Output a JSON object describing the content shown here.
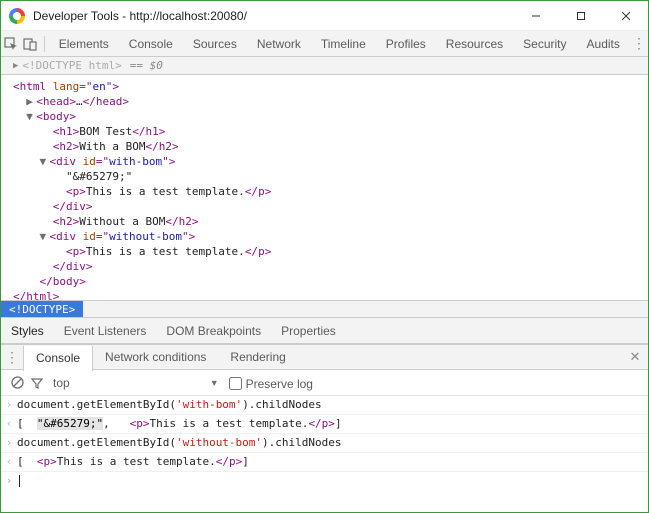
{
  "window": {
    "title": "Developer Tools - http://localhost:20080/"
  },
  "toolbar": {
    "tabs": [
      "Elements",
      "Console",
      "Sources",
      "Network",
      "Timeline",
      "Profiles",
      "Resources",
      "Security",
      "Audits"
    ]
  },
  "breadcrumb": {
    "doctype": "<!DOCTYPE html>",
    "selected": "== $0"
  },
  "dom": {
    "l0": "<html lang=\"en\">",
    "l1_open": "<head>",
    "l1_dots": "…",
    "l1_close": "</head>",
    "l2": "<body>",
    "l3_open": "<h1>",
    "l3_txt": "BOM Test",
    "l3_close": "</h1>",
    "l4_open": "<h2>",
    "l4_txt": "With a BOM",
    "l4_close": "</h2>",
    "l5": "<div id=\"with-bom\">",
    "l6": "\"&#65279;\"",
    "l7_open": "<p>",
    "l7_txt": "This is a test template.",
    "l7_close": "</p>",
    "l8": "</div>",
    "l9_open": "<h2>",
    "l9_txt": "Without a BOM",
    "l9_close": "</h2>",
    "l10": "<div id=\"without-bom\">",
    "l11_open": "<p>",
    "l11_txt": "This is a test template.",
    "l11_close": "</p>",
    "l12": "</div>",
    "l13": "</body>",
    "l14": "</html>"
  },
  "crumb": {
    "chip": "<!DOCTYPE>"
  },
  "subtabs": [
    "Styles",
    "Event Listeners",
    "DOM Breakpoints",
    "Properties"
  ],
  "drawer": {
    "tabs": [
      "Console",
      "Network conditions",
      "Rendering"
    ]
  },
  "consoleToolbar": {
    "context": "top",
    "preserve": "Preserve log"
  },
  "console": {
    "r1_a": "document.getElementById(",
    "r1_b": "'with-bom'",
    "r1_c": ").childNodes",
    "r2_a": "[  ",
    "r2_hl": "\"&#65279;\"",
    "r2_b": ",   ",
    "r2_tag_o": "<p>",
    "r2_txt": "This is a test template.",
    "r2_tag_c": "</p>",
    "r2_end": "]",
    "r3_a": "document.getElementById(",
    "r3_b": "'without-bom'",
    "r3_c": ").childNodes",
    "r4_a": "[  ",
    "r4_tag_o": "<p>",
    "r4_txt": "This is a test template.",
    "r4_tag_c": "</p>",
    "r4_end": "]"
  }
}
